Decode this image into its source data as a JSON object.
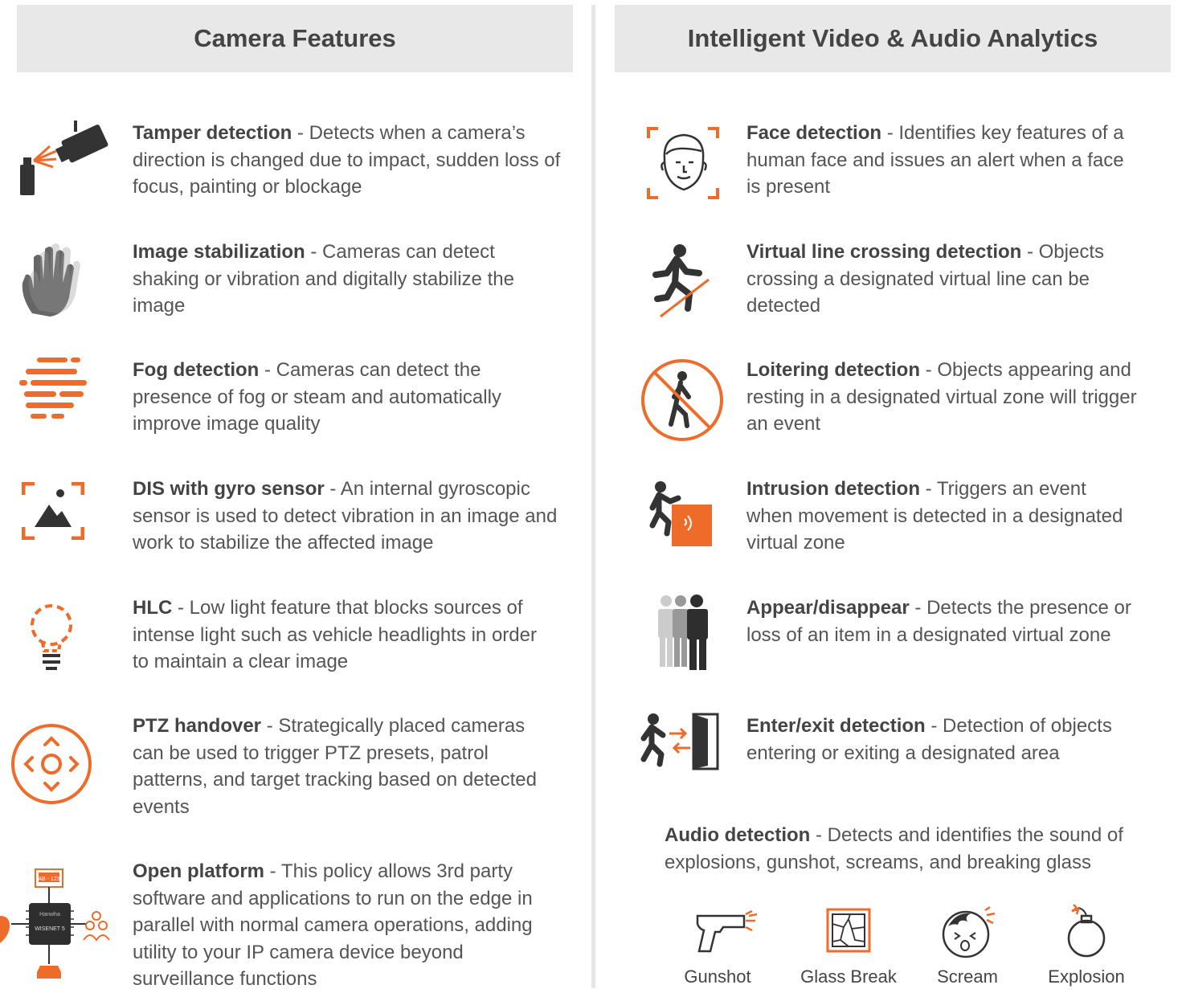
{
  "colors": {
    "accent": "#ef6b2a",
    "header_bg": "#e8e8e8",
    "icon_dark": "#333333",
    "text": "#555555"
  },
  "left": {
    "header": "Camera Features",
    "features": [
      {
        "name": "Tamper detection",
        "desc": " - Detects when a camera’s direction is changed due to impact, sudden loss of focus, painting or blockage",
        "icon": "spray-camera-icon"
      },
      {
        "name": "Image stabilization",
        "desc": " - Cameras can detect shaking or vibration and digitally stabilize the image",
        "icon": "shaking-hand-icon"
      },
      {
        "name": "Fog detection",
        "desc": " - Cameras can detect the presence of fog or steam and automatically improve image quality",
        "icon": "fog-icon"
      },
      {
        "name": "DIS with gyro sensor",
        "desc": " - An internal gyroscopic sensor is used to detect vibration in an image and work to stabilize the affected image",
        "icon": "framed-image-icon"
      },
      {
        "name": "HLC",
        "desc": " - Low light feature that blocks sources of intense light such as vehicle headlights in order to maintain a clear image",
        "icon": "lightbulb-icon"
      },
      {
        "name": "PTZ handover",
        "desc": " - Strategically placed cameras can be used to trigger PTZ presets, patrol patterns, and target tracking based on detected events",
        "icon": "ptz-control-icon"
      },
      {
        "name": "Open platform",
        "desc": " - This policy allows 3rd party software and applications to run on the edge in parallel with normal camera operations, adding utility to your IP camera device beyond surveillance functions",
        "icon": "chip-platform-icon"
      }
    ],
    "chip": {
      "brand": "Hanwha",
      "model": "WISENET 5",
      "plate": "AB - 123"
    }
  },
  "right": {
    "header": "Intelligent Video & Audio Analytics",
    "features": [
      {
        "name": "Face detection",
        "desc": " - Identifies key features of a human face and issues an alert when a face is present",
        "icon": "face-frame-icon"
      },
      {
        "name": "Virtual line crossing detection",
        "desc": " - Objects crossing a designated virtual line can be detected",
        "icon": "line-crossing-icon"
      },
      {
        "name": "Loitering detection",
        "desc": " - Objects appearing and resting in a designated virtual zone will trigger an event",
        "icon": "no-loitering-icon"
      },
      {
        "name": "Intrusion detection",
        "desc": " - Triggers an event when movement is detected in a designated virtual zone",
        "icon": "intrusion-icon"
      },
      {
        "name": "Appear/disappear",
        "desc": " - Detects the presence or loss of an item in a designated virtual zone",
        "icon": "fading-people-icon"
      },
      {
        "name": "Enter/exit detection",
        "desc": " - Detection of objects entering or exiting a designated area",
        "icon": "enter-exit-icon"
      }
    ],
    "audio": {
      "name": "Audio detection",
      "desc": " - Detects and identifies the sound of explosions, gunshot, screams, and breaking glass",
      "items": [
        {
          "label": "Gunshot",
          "icon": "gun-icon"
        },
        {
          "label": "Glass Break",
          "icon": "broken-glass-icon"
        },
        {
          "label": "Scream",
          "icon": "screaming-face-icon"
        },
        {
          "label": "Explosion",
          "icon": "bomb-icon"
        }
      ]
    }
  }
}
